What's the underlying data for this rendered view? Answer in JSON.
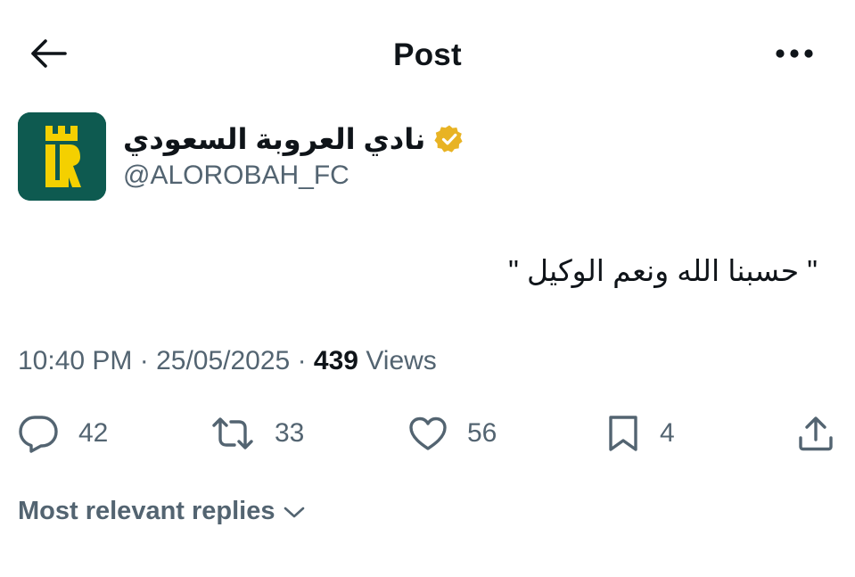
{
  "header": {
    "title": "Post",
    "back_icon": "arrow-left-icon",
    "more_icon": "more-horizontal-icon"
  },
  "author": {
    "display_name": "نادي العروبة السعودي",
    "handle": "@ALOROBAH_FC",
    "verified_icon": "verified-badge-icon",
    "verified_color": "#e8b324",
    "avatar_bg": "#0e5a50",
    "avatar_fg": "#f4d000"
  },
  "tweet": {
    "text": "\" حسبنا الله ونعم الوكيل \""
  },
  "meta": {
    "time": "10:40 PM",
    "sep1": " · ",
    "date": "25/05/2025",
    "sep2": " · ",
    "views_count": "439",
    "views_label": " Views"
  },
  "actions": {
    "reply": {
      "icon": "reply-icon",
      "count": "42"
    },
    "repost": {
      "icon": "repost-icon",
      "count": "33"
    },
    "like": {
      "icon": "heart-icon",
      "count": "56"
    },
    "bookmark": {
      "icon": "bookmark-icon",
      "count": "4"
    },
    "share": {
      "icon": "share-icon"
    }
  },
  "replies_sort": {
    "label": "Most relevant replies",
    "icon": "chevron-down-icon"
  },
  "colors": {
    "text_primary": "#0f1419",
    "text_secondary": "#536471",
    "background": "#ffffff"
  }
}
